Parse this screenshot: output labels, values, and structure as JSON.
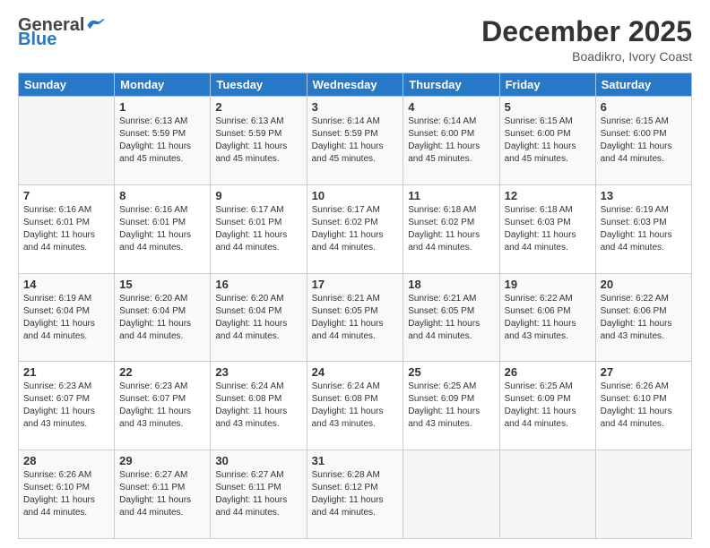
{
  "header": {
    "logo_general": "General",
    "logo_blue": "Blue",
    "title": "December 2025",
    "subtitle": "Boadikro, Ivory Coast"
  },
  "calendar": {
    "days_of_week": [
      "Sunday",
      "Monday",
      "Tuesday",
      "Wednesday",
      "Thursday",
      "Friday",
      "Saturday"
    ],
    "weeks": [
      [
        {
          "day": "",
          "info": ""
        },
        {
          "day": "1",
          "info": "Sunrise: 6:13 AM\nSunset: 5:59 PM\nDaylight: 11 hours\nand 45 minutes."
        },
        {
          "day": "2",
          "info": "Sunrise: 6:13 AM\nSunset: 5:59 PM\nDaylight: 11 hours\nand 45 minutes."
        },
        {
          "day": "3",
          "info": "Sunrise: 6:14 AM\nSunset: 5:59 PM\nDaylight: 11 hours\nand 45 minutes."
        },
        {
          "day": "4",
          "info": "Sunrise: 6:14 AM\nSunset: 6:00 PM\nDaylight: 11 hours\nand 45 minutes."
        },
        {
          "day": "5",
          "info": "Sunrise: 6:15 AM\nSunset: 6:00 PM\nDaylight: 11 hours\nand 45 minutes."
        },
        {
          "day": "6",
          "info": "Sunrise: 6:15 AM\nSunset: 6:00 PM\nDaylight: 11 hours\nand 44 minutes."
        }
      ],
      [
        {
          "day": "7",
          "info": "Sunrise: 6:16 AM\nSunset: 6:01 PM\nDaylight: 11 hours\nand 44 minutes."
        },
        {
          "day": "8",
          "info": "Sunrise: 6:16 AM\nSunset: 6:01 PM\nDaylight: 11 hours\nand 44 minutes."
        },
        {
          "day": "9",
          "info": "Sunrise: 6:17 AM\nSunset: 6:01 PM\nDaylight: 11 hours\nand 44 minutes."
        },
        {
          "day": "10",
          "info": "Sunrise: 6:17 AM\nSunset: 6:02 PM\nDaylight: 11 hours\nand 44 minutes."
        },
        {
          "day": "11",
          "info": "Sunrise: 6:18 AM\nSunset: 6:02 PM\nDaylight: 11 hours\nand 44 minutes."
        },
        {
          "day": "12",
          "info": "Sunrise: 6:18 AM\nSunset: 6:03 PM\nDaylight: 11 hours\nand 44 minutes."
        },
        {
          "day": "13",
          "info": "Sunrise: 6:19 AM\nSunset: 6:03 PM\nDaylight: 11 hours\nand 44 minutes."
        }
      ],
      [
        {
          "day": "14",
          "info": "Sunrise: 6:19 AM\nSunset: 6:04 PM\nDaylight: 11 hours\nand 44 minutes."
        },
        {
          "day": "15",
          "info": "Sunrise: 6:20 AM\nSunset: 6:04 PM\nDaylight: 11 hours\nand 44 minutes."
        },
        {
          "day": "16",
          "info": "Sunrise: 6:20 AM\nSunset: 6:04 PM\nDaylight: 11 hours\nand 44 minutes."
        },
        {
          "day": "17",
          "info": "Sunrise: 6:21 AM\nSunset: 6:05 PM\nDaylight: 11 hours\nand 44 minutes."
        },
        {
          "day": "18",
          "info": "Sunrise: 6:21 AM\nSunset: 6:05 PM\nDaylight: 11 hours\nand 44 minutes."
        },
        {
          "day": "19",
          "info": "Sunrise: 6:22 AM\nSunset: 6:06 PM\nDaylight: 11 hours\nand 43 minutes."
        },
        {
          "day": "20",
          "info": "Sunrise: 6:22 AM\nSunset: 6:06 PM\nDaylight: 11 hours\nand 43 minutes."
        }
      ],
      [
        {
          "day": "21",
          "info": "Sunrise: 6:23 AM\nSunset: 6:07 PM\nDaylight: 11 hours\nand 43 minutes."
        },
        {
          "day": "22",
          "info": "Sunrise: 6:23 AM\nSunset: 6:07 PM\nDaylight: 11 hours\nand 43 minutes."
        },
        {
          "day": "23",
          "info": "Sunrise: 6:24 AM\nSunset: 6:08 PM\nDaylight: 11 hours\nand 43 minutes."
        },
        {
          "day": "24",
          "info": "Sunrise: 6:24 AM\nSunset: 6:08 PM\nDaylight: 11 hours\nand 43 minutes."
        },
        {
          "day": "25",
          "info": "Sunrise: 6:25 AM\nSunset: 6:09 PM\nDaylight: 11 hours\nand 43 minutes."
        },
        {
          "day": "26",
          "info": "Sunrise: 6:25 AM\nSunset: 6:09 PM\nDaylight: 11 hours\nand 44 minutes."
        },
        {
          "day": "27",
          "info": "Sunrise: 6:26 AM\nSunset: 6:10 PM\nDaylight: 11 hours\nand 44 minutes."
        }
      ],
      [
        {
          "day": "28",
          "info": "Sunrise: 6:26 AM\nSunset: 6:10 PM\nDaylight: 11 hours\nand 44 minutes."
        },
        {
          "day": "29",
          "info": "Sunrise: 6:27 AM\nSunset: 6:11 PM\nDaylight: 11 hours\nand 44 minutes."
        },
        {
          "day": "30",
          "info": "Sunrise: 6:27 AM\nSunset: 6:11 PM\nDaylight: 11 hours\nand 44 minutes."
        },
        {
          "day": "31",
          "info": "Sunrise: 6:28 AM\nSunset: 6:12 PM\nDaylight: 11 hours\nand 44 minutes."
        },
        {
          "day": "",
          "info": ""
        },
        {
          "day": "",
          "info": ""
        },
        {
          "day": "",
          "info": ""
        }
      ]
    ]
  }
}
